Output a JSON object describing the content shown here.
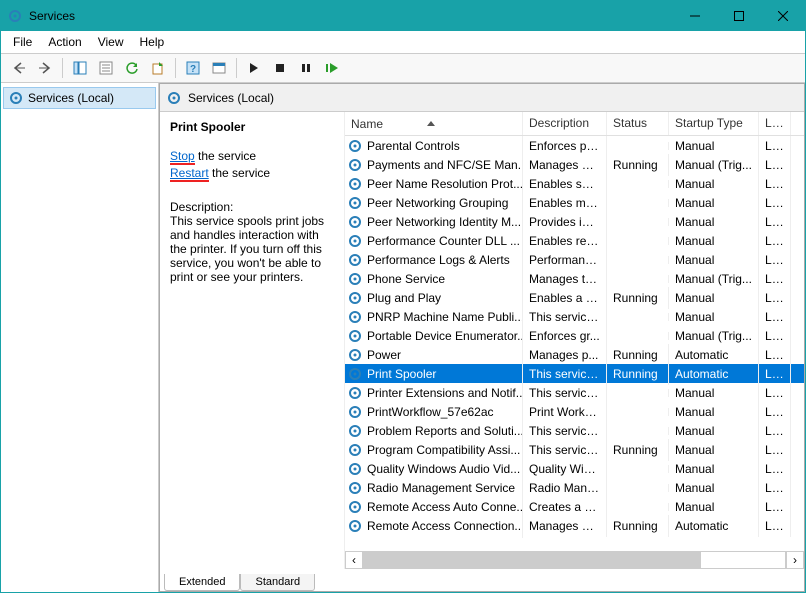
{
  "window": {
    "title": "Services"
  },
  "menu": {
    "file": "File",
    "action": "Action",
    "view": "View",
    "help": "Help"
  },
  "nav": {
    "root": "Services (Local)"
  },
  "header": {
    "label": "Services (Local)"
  },
  "detail": {
    "title": "Print Spooler",
    "stop_link": "Stop",
    "stop_suffix": " the service",
    "restart_link": "Restart",
    "restart_suffix": " the service",
    "description_label": "Description:",
    "description_text": "This service spools print jobs and handles interaction with the printer. If you turn off this service, you won't be able to print or see your printers."
  },
  "columns": {
    "name": "Name",
    "description": "Description",
    "status": "Status",
    "startup": "Startup Type",
    "logon": "Log"
  },
  "services": [
    {
      "name": "Parental Controls",
      "desc": "Enforces pa...",
      "status": "",
      "startup": "Manual",
      "log": "Loc"
    },
    {
      "name": "Payments and NFC/SE Man...",
      "desc": "Manages pa...",
      "status": "Running",
      "startup": "Manual (Trig...",
      "log": "Loc"
    },
    {
      "name": "Peer Name Resolution Prot...",
      "desc": "Enables serv...",
      "status": "",
      "startup": "Manual",
      "log": "Loc"
    },
    {
      "name": "Peer Networking Grouping",
      "desc": "Enables mul...",
      "status": "",
      "startup": "Manual",
      "log": "Loc"
    },
    {
      "name": "Peer Networking Identity M...",
      "desc": "Provides ide...",
      "status": "",
      "startup": "Manual",
      "log": "Loc"
    },
    {
      "name": "Performance Counter DLL ...",
      "desc": "Enables rem...",
      "status": "",
      "startup": "Manual",
      "log": "Loc"
    },
    {
      "name": "Performance Logs & Alerts",
      "desc": "Performanc...",
      "status": "",
      "startup": "Manual",
      "log": "Loc"
    },
    {
      "name": "Phone Service",
      "desc": "Manages th...",
      "status": "",
      "startup": "Manual (Trig...",
      "log": "Loc"
    },
    {
      "name": "Plug and Play",
      "desc": "Enables a c...",
      "status": "Running",
      "startup": "Manual",
      "log": "Loc"
    },
    {
      "name": "PNRP Machine Name Publi...",
      "desc": "This service ...",
      "status": "",
      "startup": "Manual",
      "log": "Loc"
    },
    {
      "name": "Portable Device Enumerator...",
      "desc": "Enforces gr...",
      "status": "",
      "startup": "Manual (Trig...",
      "log": "Loc"
    },
    {
      "name": "Power",
      "desc": "Manages p...",
      "status": "Running",
      "startup": "Automatic",
      "log": "Loc"
    },
    {
      "name": "Print Spooler",
      "desc": "This service ...",
      "status": "Running",
      "startup": "Automatic",
      "log": "Loc",
      "selected": true
    },
    {
      "name": "Printer Extensions and Notif...",
      "desc": "This service ...",
      "status": "",
      "startup": "Manual",
      "log": "Loc"
    },
    {
      "name": "PrintWorkflow_57e62ac",
      "desc": "Print Workfl...",
      "status": "",
      "startup": "Manual",
      "log": "Loc"
    },
    {
      "name": "Problem Reports and Soluti...",
      "desc": "This service ...",
      "status": "",
      "startup": "Manual",
      "log": "Loc"
    },
    {
      "name": "Program Compatibility Assi...",
      "desc": "This service ...",
      "status": "Running",
      "startup": "Manual",
      "log": "Loc"
    },
    {
      "name": "Quality Windows Audio Vid...",
      "desc": "Quality Win...",
      "status": "",
      "startup": "Manual",
      "log": "Loc"
    },
    {
      "name": "Radio Management Service",
      "desc": "Radio Mana...",
      "status": "",
      "startup": "Manual",
      "log": "Loc"
    },
    {
      "name": "Remote Access Auto Conne...",
      "desc": "Creates a co...",
      "status": "",
      "startup": "Manual",
      "log": "Loc"
    },
    {
      "name": "Remote Access Connection...",
      "desc": "Manages di...",
      "status": "Running",
      "startup": "Automatic",
      "log": "Loc"
    }
  ],
  "tabs": {
    "extended": "Extended",
    "standard": "Standard"
  }
}
